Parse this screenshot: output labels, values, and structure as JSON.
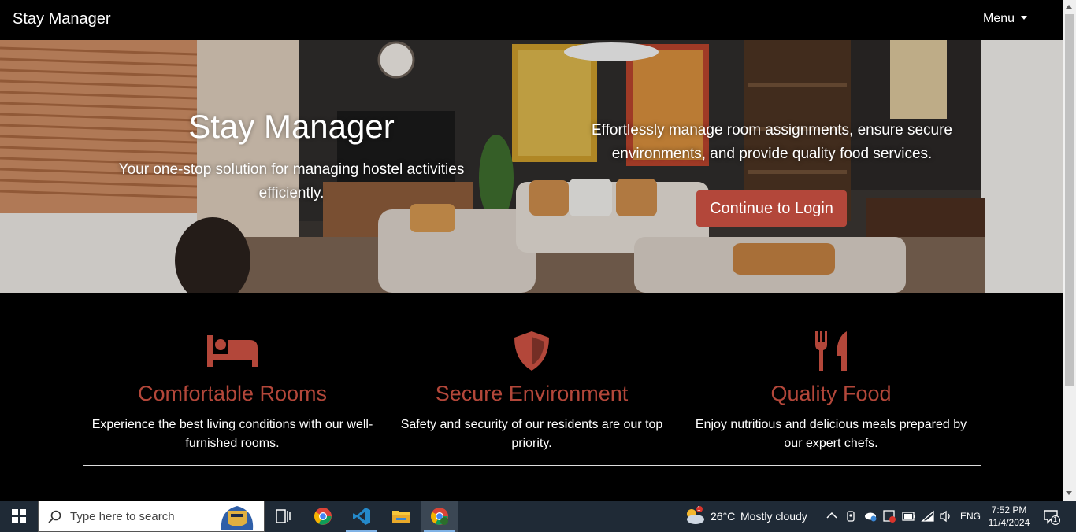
{
  "navbar": {
    "brand": "Stay Manager",
    "menu_label": "Menu"
  },
  "hero": {
    "title": "Stay Manager",
    "subtitle": "Your one-stop solution for managing hostel activities efficiently.",
    "description": "Effortlessly manage room assignments, ensure secure environments, and provide quality food services.",
    "login_button": "Continue to Login"
  },
  "features": [
    {
      "icon": "bed-icon",
      "title": "Comfortable Rooms",
      "text": "Experience the best living conditions with our well-furnished rooms."
    },
    {
      "icon": "shield-icon",
      "title": "Secure Environment",
      "text": "Safety and security of our residents are our top priority."
    },
    {
      "icon": "utensils-icon",
      "title": "Quality Food",
      "text": "Enjoy nutritious and delicious meals prepared by our expert chefs."
    }
  ],
  "colors": {
    "accent": "#b3473a",
    "background": "#000000",
    "text": "#ffffff"
  },
  "taskbar": {
    "search_placeholder": "Type here to search",
    "weather_temp": "26°C",
    "weather_desc": "Mostly cloudy",
    "weather_badge": "1",
    "language": "ENG",
    "time": "7:52 PM",
    "date": "11/4/2024",
    "notification_count": "1"
  }
}
